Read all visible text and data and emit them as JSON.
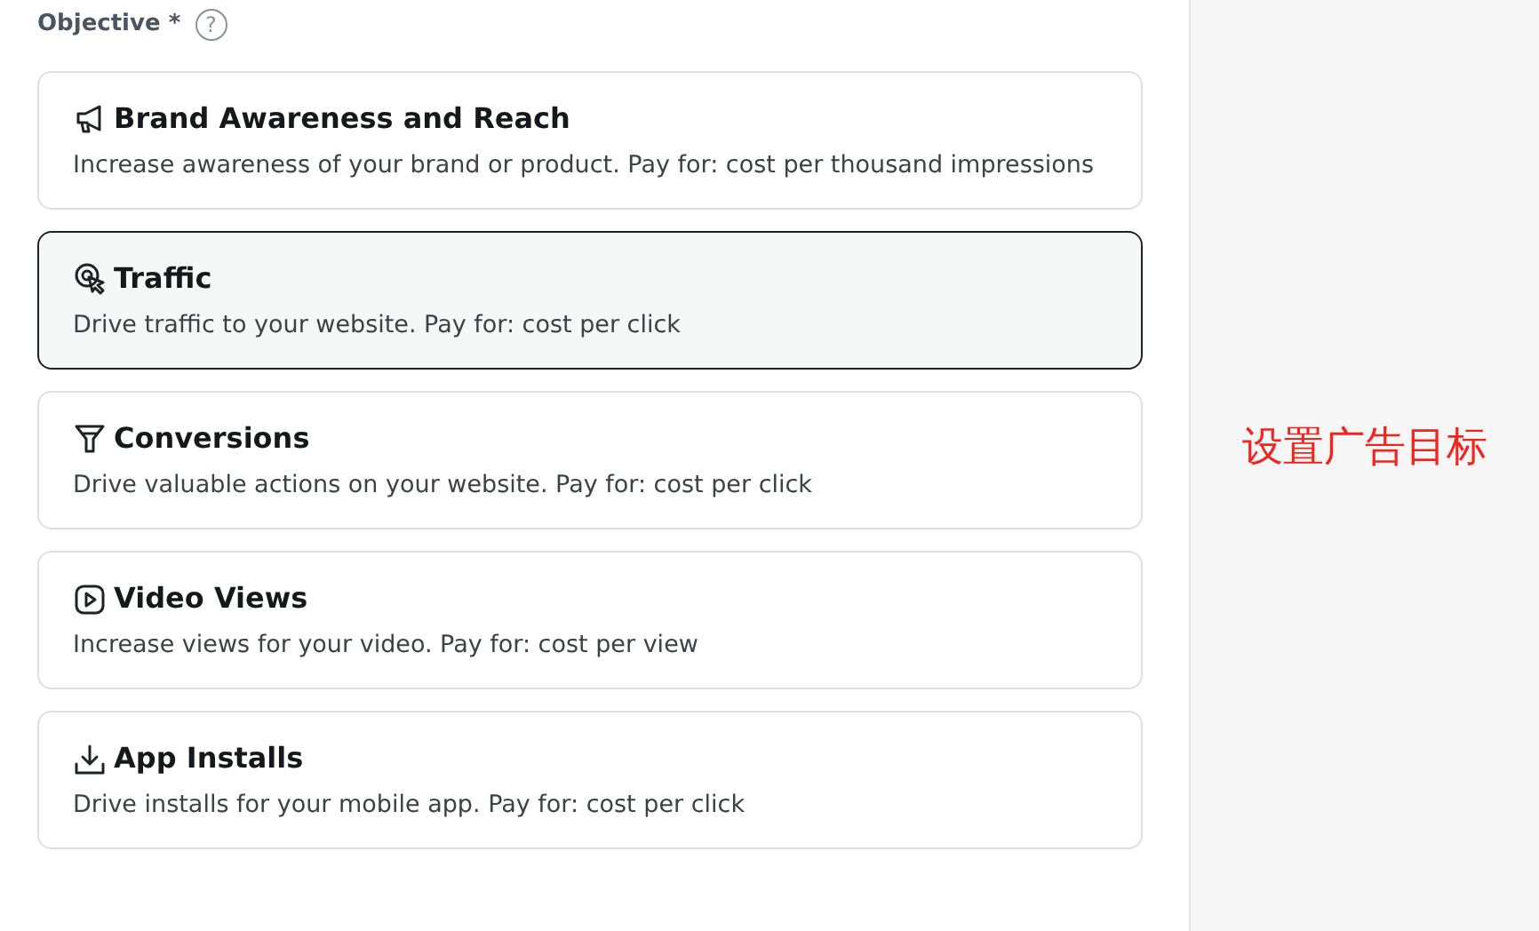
{
  "field": {
    "label": "Objective *",
    "help": "?"
  },
  "options": [
    {
      "kind": "megaphone",
      "title": "Brand Awareness and Reach",
      "description": "Increase awareness of your brand or product. Pay for: cost per thousand impressions",
      "selected": false
    },
    {
      "kind": "cursor",
      "title": "Traffic",
      "description": "Drive traffic to your website. Pay for: cost per click",
      "selected": true
    },
    {
      "kind": "funnel",
      "title": "Conversions",
      "description": "Drive valuable actions on your website. Pay for: cost per click",
      "selected": false
    },
    {
      "kind": "video",
      "title": "Video Views",
      "description": "Increase views for your video. Pay for: cost per view",
      "selected": false
    },
    {
      "kind": "download",
      "title": "App Installs",
      "description": "Drive installs for your mobile app. Pay for: cost per click",
      "selected": false
    }
  ],
  "annotation": "设置广告目标"
}
